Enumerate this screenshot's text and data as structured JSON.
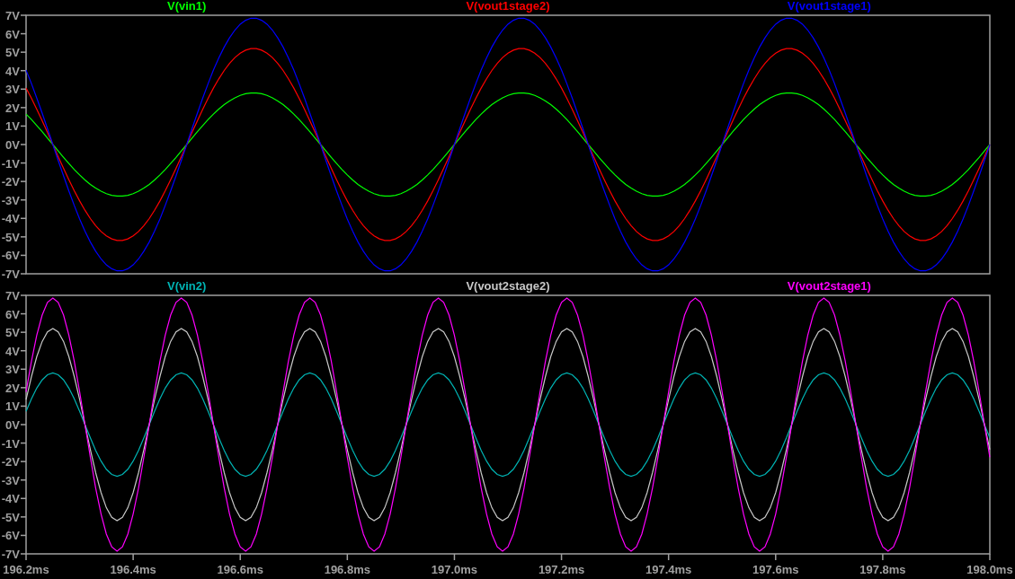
{
  "top_panel": {
    "chart_data": {
      "type": "line",
      "x": [
        196.2,
        196.21,
        196.22,
        196.23,
        196.24,
        196.25,
        196.26,
        196.27,
        196.28,
        196.29,
        196.3,
        196.31,
        196.32,
        196.33,
        196.34,
        196.35,
        196.36,
        196.37,
        196.38,
        196.39,
        196.4,
        196.41,
        196.42,
        196.43,
        196.44,
        196.45,
        196.46,
        196.47,
        196.48,
        196.49,
        196.5,
        196.51,
        196.52,
        196.53,
        196.54,
        196.55,
        196.56,
        196.57,
        196.58,
        196.59,
        196.6,
        196.61,
        196.62,
        196.63,
        196.64,
        196.65,
        196.66,
        196.67,
        196.68,
        196.69,
        196.7,
        196.71,
        196.72,
        196.73,
        196.74,
        196.75,
        196.76,
        196.77,
        196.78,
        196.79,
        196.8,
        196.81,
        196.82,
        196.83,
        196.84,
        196.85,
        196.86,
        196.87,
        196.88,
        196.89,
        196.9,
        196.91,
        196.92,
        196.93,
        196.94,
        196.95,
        196.96,
        196.97,
        196.98,
        196.99,
        197,
        197.01,
        197.02,
        197.03,
        197.04,
        197.05,
        197.06,
        197.07,
        197.08,
        197.09,
        197.1,
        197.11,
        197.12,
        197.13,
        197.14,
        197.15,
        197.16,
        197.17,
        197.18,
        197.19,
        197.2,
        197.21,
        197.22,
        197.23,
        197.24,
        197.25,
        197.26,
        197.27,
        197.28,
        197.29,
        197.3,
        197.31,
        197.32,
        197.33,
        197.34,
        197.35,
        197.36,
        197.37,
        197.38,
        197.39,
        197.4,
        197.41,
        197.42,
        197.43,
        197.44,
        197.45,
        197.46,
        197.47,
        197.48,
        197.49,
        197.5,
        197.51,
        197.52,
        197.53,
        197.54,
        197.55,
        197.56,
        197.57,
        197.58,
        197.59,
        197.6,
        197.61,
        197.62,
        197.63,
        197.64,
        197.65,
        197.66,
        197.67,
        197.68,
        197.69,
        197.7,
        197.71,
        197.72,
        197.73,
        197.74,
        197.75,
        197.76,
        197.77,
        197.78,
        197.79,
        197.8,
        197.81,
        197.82,
        197.83,
        197.84,
        197.85,
        197.86,
        197.87,
        197.88,
        197.89,
        197.9,
        197.91,
        197.92,
        197.93,
        197.94,
        197.95,
        197.96,
        197.97,
        197.98,
        197.99,
        198
      ],
      "series": [
        {
          "name": "V(vin1)",
          "color": "#00ff00",
          "values": [
            1.65,
            1.35,
            1.03,
            0.7,
            0.35,
            0,
            -0.35,
            -0.7,
            -1.03,
            -1.35,
            -1.65,
            -1.92,
            -2.16,
            -2.36,
            -2.53,
            -2.66,
            -2.75,
            -2.79,
            -2.79,
            -2.75,
            -2.66,
            -2.53,
            -2.36,
            -2.16,
            -1.92,
            -1.65,
            -1.35,
            -1.03,
            -0.7,
            -0.35,
            0,
            0.35,
            0.7,
            1.03,
            1.35,
            1.65,
            1.92,
            2.16,
            2.36,
            2.53,
            2.66,
            2.75,
            2.79,
            2.79,
            2.75,
            2.66,
            2.53,
            2.36,
            2.16,
            1.92,
            1.65,
            1.35,
            1.03,
            0.7,
            0.35,
            0,
            -0.35,
            -0.7,
            -1.03,
            -1.35,
            -1.65,
            -1.92,
            -2.16,
            -2.36,
            -2.53,
            -2.66,
            -2.75,
            -2.79,
            -2.79,
            -2.75,
            -2.66,
            -2.53,
            -2.36,
            -2.16,
            -1.92,
            -1.65,
            -1.35,
            -1.03,
            -0.7,
            -0.35,
            0,
            0.35,
            0.7,
            1.03,
            1.35,
            1.65,
            1.92,
            2.16,
            2.36,
            2.53,
            2.66,
            2.75,
            2.79,
            2.79,
            2.75,
            2.66,
            2.53,
            2.36,
            2.16,
            1.92,
            1.65,
            1.35,
            1.03,
            0.7,
            0.35,
            0,
            -0.35,
            -0.7,
            -1.03,
            -1.35,
            -1.65,
            -1.92,
            -2.16,
            -2.36,
            -2.53,
            -2.66,
            -2.75,
            -2.79,
            -2.79,
            -2.75,
            -2.66,
            -2.53,
            -2.36,
            -2.16,
            -1.92,
            -1.65,
            -1.35,
            -1.03,
            -0.7,
            -0.35,
            0,
            0.35,
            0.7,
            1.03,
            1.35,
            1.65,
            1.92,
            2.16,
            2.36,
            2.53,
            2.66,
            2.75,
            2.79,
            2.79,
            2.75,
            2.66,
            2.53,
            2.36,
            2.16,
            1.92,
            1.65,
            1.35,
            1.03,
            0.7,
            0.35,
            0,
            -0.35,
            -0.7,
            -1.03,
            -1.35,
            -1.65,
            -1.92,
            -2.16,
            -2.36,
            -2.53,
            -2.66,
            -2.75,
            -2.79,
            -2.79,
            -2.75,
            -2.66,
            -2.53,
            -2.36,
            -2.16,
            -1.92,
            -1.65,
            -1.35,
            -1.03,
            -0.7,
            -0.35,
            0
          ]
        },
        {
          "name": "V(vout1stage2)",
          "color": "#ff0000",
          "values": [
            3.06,
            2.51,
            1.91,
            1.29,
            0.65,
            0,
            -0.65,
            -1.29,
            -1.91,
            -2.51,
            -3.06,
            -3.56,
            -4.01,
            -4.39,
            -4.71,
            -4.95,
            -5.11,
            -5.19,
            -5.19,
            -5.11,
            -4.95,
            -4.71,
            -4.39,
            -4.01,
            -3.56,
            -3.06,
            -2.51,
            -1.91,
            -1.29,
            -0.65,
            0,
            0.65,
            1.29,
            1.91,
            2.51,
            3.06,
            3.56,
            4.01,
            4.39,
            4.71,
            4.95,
            5.11,
            5.19,
            5.19,
            5.11,
            4.95,
            4.71,
            4.39,
            4.01,
            3.56,
            3.06,
            2.51,
            1.91,
            1.29,
            0.65,
            0,
            -0.65,
            -1.29,
            -1.91,
            -2.51,
            -3.06,
            -3.56,
            -4.01,
            -4.39,
            -4.71,
            -4.95,
            -5.11,
            -5.19,
            -5.19,
            -5.11,
            -4.95,
            -4.71,
            -4.39,
            -4.01,
            -3.56,
            -3.06,
            -2.51,
            -1.91,
            -1.29,
            -0.65,
            0,
            0.65,
            1.29,
            1.91,
            2.51,
            3.06,
            3.56,
            4.01,
            4.39,
            4.71,
            4.95,
            5.11,
            5.19,
            5.19,
            5.11,
            4.95,
            4.71,
            4.39,
            4.01,
            3.56,
            3.06,
            2.51,
            1.91,
            1.29,
            0.65,
            0,
            -0.65,
            -1.29,
            -1.91,
            -2.51,
            -3.06,
            -3.56,
            -4.01,
            -4.39,
            -4.71,
            -4.95,
            -5.11,
            -5.19,
            -5.19,
            -5.11,
            -4.95,
            -4.71,
            -4.39,
            -4.01,
            -3.56,
            -3.06,
            -2.51,
            -1.91,
            -1.29,
            -0.65,
            0,
            0.65,
            1.29,
            1.91,
            2.51,
            3.06,
            3.56,
            4.01,
            4.39,
            4.71,
            4.95,
            5.11,
            5.19,
            5.19,
            5.11,
            4.95,
            4.71,
            4.39,
            4.01,
            3.56,
            3.06,
            2.51,
            1.91,
            1.29,
            0.65,
            0,
            -0.65,
            -1.29,
            -1.91,
            -2.51,
            -3.06,
            -3.56,
            -4.01,
            -4.39,
            -4.71,
            -4.95,
            -5.11,
            -5.19,
            -5.19,
            -5.11,
            -4.95,
            -4.71,
            -4.39,
            -4.01,
            -3.56,
            -3.06,
            -2.51,
            -1.91,
            -1.29,
            -0.65,
            0
          ]
        },
        {
          "name": "V(vout1stage1)",
          "color": "#0000ff",
          "values": [
            4.03,
            3.3,
            2.52,
            1.7,
            0.86,
            0,
            -0.86,
            -1.7,
            -2.52,
            -3.3,
            -4.03,
            -4.69,
            -5.28,
            -5.78,
            -6.2,
            -6.52,
            -6.73,
            -6.84,
            -6.84,
            -6.73,
            -6.52,
            -6.2,
            -5.78,
            -5.28,
            -4.69,
            -4.03,
            -3.3,
            -2.52,
            -1.7,
            -0.86,
            0,
            0.86,
            1.7,
            2.52,
            3.3,
            4.03,
            4.69,
            5.28,
            5.78,
            6.2,
            6.52,
            6.73,
            6.84,
            6.84,
            6.73,
            6.52,
            6.2,
            5.78,
            5.28,
            4.69,
            4.03,
            3.3,
            2.52,
            1.7,
            0.86,
            0,
            -0.86,
            -1.7,
            -2.52,
            -3.3,
            -4.03,
            -4.69,
            -5.28,
            -5.78,
            -6.2,
            -6.52,
            -6.73,
            -6.84,
            -6.84,
            -6.73,
            -6.52,
            -6.2,
            -5.78,
            -5.28,
            -4.69,
            -4.03,
            -3.3,
            -2.52,
            -1.7,
            -0.86,
            0,
            0.86,
            1.7,
            2.52,
            3.3,
            4.03,
            4.69,
            5.28,
            5.78,
            6.2,
            6.52,
            6.73,
            6.84,
            6.84,
            6.73,
            6.52,
            6.2,
            5.78,
            5.28,
            4.69,
            4.03,
            3.3,
            2.52,
            1.7,
            0.86,
            0,
            -0.86,
            -1.7,
            -2.52,
            -3.3,
            -4.03,
            -4.69,
            -5.28,
            -5.78,
            -6.2,
            -6.52,
            -6.73,
            -6.84,
            -6.84,
            -6.73,
            -6.52,
            -6.2,
            -5.78,
            -5.28,
            -4.69,
            -4.03,
            -3.3,
            -2.52,
            -1.7,
            -0.86,
            0,
            0.86,
            1.7,
            2.52,
            3.3,
            4.03,
            4.69,
            5.28,
            5.78,
            6.2,
            6.52,
            6.73,
            6.84,
            6.84,
            6.73,
            6.52,
            6.2,
            5.78,
            5.28,
            4.69,
            4.03,
            3.3,
            2.52,
            1.7,
            0.86,
            0,
            -0.86,
            -1.7,
            -2.52,
            -3.3,
            -4.03,
            -4.69,
            -5.28,
            -5.78,
            -6.2,
            -6.52,
            -6.73,
            -6.84,
            -6.84,
            -6.73,
            -6.52,
            -6.2,
            -5.78,
            -5.28,
            -4.69,
            -4.03,
            -3.3,
            -2.52,
            -1.7,
            -0.86,
            0
          ]
        }
      ],
      "xlim": [
        196.2,
        198.0
      ],
      "ylim": [
        -7,
        7
      ],
      "yticks": [
        {
          "value": 7,
          "label": "7V"
        },
        {
          "value": 6,
          "label": "6V"
        },
        {
          "value": 5,
          "label": "5V"
        },
        {
          "value": 4,
          "label": "4V"
        },
        {
          "value": 3,
          "label": "3V"
        },
        {
          "value": 2,
          "label": "2V"
        },
        {
          "value": 1,
          "label": "1V"
        },
        {
          "value": 0,
          "label": "0V"
        },
        {
          "value": -1,
          "label": "-1V"
        },
        {
          "value": -2,
          "label": "-2V"
        },
        {
          "value": -3,
          "label": "-3V"
        },
        {
          "value": -4,
          "label": "-4V"
        },
        {
          "value": -5,
          "label": "-5V"
        },
        {
          "value": -6,
          "label": "-6V"
        },
        {
          "value": -7,
          "label": "-7V"
        }
      ]
    }
  },
  "bottom_panel": {
    "chart_data": {
      "type": "line",
      "x": [
        196.2,
        196.21,
        196.22,
        196.23,
        196.24,
        196.25,
        196.26,
        196.27,
        196.28,
        196.29,
        196.3,
        196.31,
        196.32,
        196.33,
        196.34,
        196.35,
        196.36,
        196.37,
        196.38,
        196.39,
        196.4,
        196.41,
        196.42,
        196.43,
        196.44,
        196.45,
        196.46,
        196.47,
        196.48,
        196.49,
        196.5,
        196.51,
        196.52,
        196.53,
        196.54,
        196.55,
        196.56,
        196.57,
        196.58,
        196.59,
        196.6,
        196.61,
        196.62,
        196.63,
        196.64,
        196.65,
        196.66,
        196.67,
        196.68,
        196.69,
        196.7,
        196.71,
        196.72,
        196.73,
        196.74,
        196.75,
        196.76,
        196.77,
        196.78,
        196.79,
        196.8,
        196.81,
        196.82,
        196.83,
        196.84,
        196.85,
        196.86,
        196.87,
        196.88,
        196.89,
        196.9,
        196.91,
        196.92,
        196.93,
        196.94,
        196.95,
        196.96,
        196.97,
        196.98,
        196.99,
        197,
        197.01,
        197.02,
        197.03,
        197.04,
        197.05,
        197.06,
        197.07,
        197.08,
        197.09,
        197.1,
        197.11,
        197.12,
        197.13,
        197.14,
        197.15,
        197.16,
        197.17,
        197.18,
        197.19,
        197.2,
        197.21,
        197.22,
        197.23,
        197.24,
        197.25,
        197.26,
        197.27,
        197.28,
        197.29,
        197.3,
        197.31,
        197.32,
        197.33,
        197.34,
        197.35,
        197.36,
        197.37,
        197.38,
        197.39,
        197.4,
        197.41,
        197.42,
        197.43,
        197.44,
        197.45,
        197.46,
        197.47,
        197.48,
        197.49,
        197.5,
        197.51,
        197.52,
        197.53,
        197.54,
        197.55,
        197.56,
        197.57,
        197.58,
        197.59,
        197.6,
        197.61,
        197.62,
        197.63,
        197.64,
        197.65,
        197.66,
        197.67,
        197.68,
        197.69,
        197.7,
        197.71,
        197.72,
        197.73,
        197.74,
        197.75,
        197.76,
        197.77,
        197.78,
        197.79,
        197.8,
        197.81,
        197.82,
        197.83,
        197.84,
        197.85,
        197.86,
        197.87,
        197.88,
        197.89,
        197.9,
        197.91,
        197.92,
        197.93,
        197.94,
        197.95,
        197.96,
        197.97,
        197.98,
        197.99,
        198
      ],
      "series": [
        {
          "name": "V(vin2)",
          "color": "#00b4b4",
          "values": [
            0.72,
            1.4,
            1.98,
            2.42,
            2.7,
            2.8,
            2.7,
            2.42,
            1.98,
            1.4,
            0.72,
            0,
            -0.72,
            -1.4,
            -1.98,
            -2.42,
            -2.7,
            -2.8,
            -2.7,
            -2.42,
            -1.98,
            -1.4,
            -0.72,
            0,
            0.72,
            1.4,
            1.98,
            2.42,
            2.7,
            2.8,
            2.7,
            2.42,
            1.98,
            1.4,
            0.72,
            0,
            -0.72,
            -1.4,
            -1.98,
            -2.42,
            -2.7,
            -2.8,
            -2.7,
            -2.42,
            -1.98,
            -1.4,
            -0.72,
            0,
            0.72,
            1.4,
            1.98,
            2.42,
            2.7,
            2.8,
            2.7,
            2.42,
            1.98,
            1.4,
            0.72,
            0,
            -0.72,
            -1.4,
            -1.98,
            -2.42,
            -2.7,
            -2.8,
            -2.7,
            -2.42,
            -1.98,
            -1.4,
            -0.72,
            0,
            0.72,
            1.4,
            1.98,
            2.42,
            2.7,
            2.8,
            2.7,
            2.42,
            1.98,
            1.4,
            0.72,
            0,
            -0.72,
            -1.4,
            -1.98,
            -2.42,
            -2.7,
            -2.8,
            -2.7,
            -2.42,
            -1.98,
            -1.4,
            -0.72,
            0,
            0.72,
            1.4,
            1.98,
            2.42,
            2.7,
            2.8,
            2.7,
            2.42,
            1.98,
            1.4,
            0.72,
            0,
            -0.72,
            -1.4,
            -1.98,
            -2.42,
            -2.7,
            -2.8,
            -2.7,
            -2.42,
            -1.98,
            -1.4,
            -0.72,
            0,
            0.72,
            1.4,
            1.98,
            2.42,
            2.7,
            2.8,
            2.7,
            2.42,
            1.98,
            1.4,
            0.72,
            0,
            -0.72,
            -1.4,
            -1.98,
            -2.42,
            -2.7,
            -2.8,
            -2.7,
            -2.42,
            -1.98,
            -1.4,
            -0.72,
            0,
            0.72,
            1.4,
            1.98,
            2.42,
            2.7,
            2.8,
            2.7,
            2.42,
            1.98,
            1.4,
            0.72,
            0,
            -0.72,
            -1.4,
            -1.98,
            -2.42,
            -2.7,
            -2.8,
            -2.7,
            -2.42,
            -1.98,
            -1.4,
            -0.72,
            0,
            0.72,
            1.4,
            1.98,
            2.42,
            2.7,
            2.8,
            2.7,
            2.42,
            1.98,
            1.4,
            0.72,
            0,
            -0.72
          ]
        },
        {
          "name": "V(vout2stage2)",
          "color": "#c8c8c8",
          "values": [
            1.35,
            2.6,
            3.68,
            4.5,
            5.02,
            5.2,
            5.02,
            4.5,
            3.68,
            2.6,
            1.35,
            0,
            -1.35,
            -2.6,
            -3.68,
            -4.5,
            -5.02,
            -5.2,
            -5.02,
            -4.5,
            -3.68,
            -2.6,
            -1.35,
            0,
            1.35,
            2.6,
            3.68,
            4.5,
            5.02,
            5.2,
            5.02,
            4.5,
            3.68,
            2.6,
            1.35,
            0,
            -1.35,
            -2.6,
            -3.68,
            -4.5,
            -5.02,
            -5.2,
            -5.02,
            -4.5,
            -3.68,
            -2.6,
            -1.35,
            0,
            1.35,
            2.6,
            3.68,
            4.5,
            5.02,
            5.2,
            5.02,
            4.5,
            3.68,
            2.6,
            1.35,
            0,
            -1.35,
            -2.6,
            -3.68,
            -4.5,
            -5.02,
            -5.2,
            -5.02,
            -4.5,
            -3.68,
            -2.6,
            -1.35,
            0,
            1.35,
            2.6,
            3.68,
            4.5,
            5.02,
            5.2,
            5.02,
            4.5,
            3.68,
            2.6,
            1.35,
            0,
            -1.35,
            -2.6,
            -3.68,
            -4.5,
            -5.02,
            -5.2,
            -5.02,
            -4.5,
            -3.68,
            -2.6,
            -1.35,
            0,
            1.35,
            2.6,
            3.68,
            4.5,
            5.02,
            5.2,
            5.02,
            4.5,
            3.68,
            2.6,
            1.35,
            0,
            -1.35,
            -2.6,
            -3.68,
            -4.5,
            -5.02,
            -5.2,
            -5.02,
            -4.5,
            -3.68,
            -2.6,
            -1.35,
            0,
            1.35,
            2.6,
            3.68,
            4.5,
            5.02,
            5.2,
            5.02,
            4.5,
            3.68,
            2.6,
            1.35,
            0,
            -1.35,
            -2.6,
            -3.68,
            -4.5,
            -5.02,
            -5.2,
            -5.02,
            -4.5,
            -3.68,
            -2.6,
            -1.35,
            0,
            1.35,
            2.6,
            3.68,
            4.5,
            5.02,
            5.2,
            5.02,
            4.5,
            3.68,
            2.6,
            1.35,
            0,
            -1.35,
            -2.6,
            -3.68,
            -4.5,
            -5.02,
            -5.2,
            -5.02,
            -4.5,
            -3.68,
            -2.6,
            -1.35,
            0,
            1.35,
            2.6,
            3.68,
            4.5,
            5.02,
            5.2,
            5.02,
            4.5,
            3.68,
            2.6,
            1.35,
            0,
            -1.35
          ]
        },
        {
          "name": "V(vout2stage1)",
          "color": "#ff00ff",
          "values": [
            1.77,
            3.43,
            4.84,
            5.93,
            6.62,
            6.85,
            6.62,
            5.93,
            4.84,
            3.43,
            1.77,
            0,
            -1.77,
            -3.43,
            -4.84,
            -5.93,
            -6.62,
            -6.85,
            -6.62,
            -5.93,
            -4.84,
            -3.43,
            -1.77,
            0,
            1.77,
            3.43,
            4.84,
            5.93,
            6.62,
            6.85,
            6.62,
            5.93,
            4.84,
            3.43,
            1.77,
            0,
            -1.77,
            -3.43,
            -4.84,
            -5.93,
            -6.62,
            -6.85,
            -6.62,
            -5.93,
            -4.84,
            -3.43,
            -1.77,
            0,
            1.77,
            3.43,
            4.84,
            5.93,
            6.62,
            6.85,
            6.62,
            5.93,
            4.84,
            3.43,
            1.77,
            0,
            -1.77,
            -3.43,
            -4.84,
            -5.93,
            -6.62,
            -6.85,
            -6.62,
            -5.93,
            -4.84,
            -3.43,
            -1.77,
            0,
            1.77,
            3.43,
            4.84,
            5.93,
            6.62,
            6.85,
            6.62,
            5.93,
            4.84,
            3.43,
            1.77,
            0,
            -1.77,
            -3.43,
            -4.84,
            -5.93,
            -6.62,
            -6.85,
            -6.62,
            -5.93,
            -4.84,
            -3.43,
            -1.77,
            0,
            1.77,
            3.43,
            4.84,
            5.93,
            6.62,
            6.85,
            6.62,
            5.93,
            4.84,
            3.43,
            1.77,
            0,
            -1.77,
            -3.43,
            -4.84,
            -5.93,
            -6.62,
            -6.85,
            -6.62,
            -5.93,
            -4.84,
            -3.43,
            -1.77,
            0,
            1.77,
            3.43,
            4.84,
            5.93,
            6.62,
            6.85,
            6.62,
            5.93,
            4.84,
            3.43,
            1.77,
            0,
            -1.77,
            -3.43,
            -4.84,
            -5.93,
            -6.62,
            -6.85,
            -6.62,
            -5.93,
            -4.84,
            -3.43,
            -1.77,
            0,
            1.77,
            3.43,
            4.84,
            5.93,
            6.62,
            6.85,
            6.62,
            5.93,
            4.84,
            3.43,
            1.77,
            0,
            -1.77,
            -3.43,
            -4.84,
            -5.93,
            -6.62,
            -6.85,
            -6.62,
            -5.93,
            -4.84,
            -3.43,
            -1.77,
            0,
            1.77,
            3.43,
            4.84,
            5.93,
            6.62,
            6.85,
            6.62,
            5.93,
            4.84,
            3.43,
            1.77,
            0,
            -1.77
          ]
        }
      ],
      "xlim": [
        196.2,
        198.0
      ],
      "ylim": [
        -7,
        7
      ],
      "xticks": [
        {
          "value": 196.2,
          "label": "196.2ms"
        },
        {
          "value": 196.4,
          "label": "196.4ms"
        },
        {
          "value": 196.6,
          "label": "196.6ms"
        },
        {
          "value": 196.8,
          "label": "196.8ms"
        },
        {
          "value": 197.0,
          "label": "197.0ms"
        },
        {
          "value": 197.2,
          "label": "197.2ms"
        },
        {
          "value": 197.4,
          "label": "197.4ms"
        },
        {
          "value": 197.6,
          "label": "197.6ms"
        },
        {
          "value": 197.8,
          "label": "197.8ms"
        },
        {
          "value": 198.0,
          "label": "198.0ms"
        }
      ],
      "yticks": [
        {
          "value": 7,
          "label": "7V"
        },
        {
          "value": 6,
          "label": "6V"
        },
        {
          "value": 5,
          "label": "5V"
        },
        {
          "value": 4,
          "label": "4V"
        },
        {
          "value": 3,
          "label": "3V"
        },
        {
          "value": 2,
          "label": "2V"
        },
        {
          "value": 1,
          "label": "1V"
        },
        {
          "value": 0,
          "label": "0V"
        },
        {
          "value": -1,
          "label": "-1V"
        },
        {
          "value": -2,
          "label": "-2V"
        },
        {
          "value": -3,
          "label": "-3V"
        },
        {
          "value": -4,
          "label": "-4V"
        },
        {
          "value": -5,
          "label": "-5V"
        },
        {
          "value": -6,
          "label": "-6V"
        },
        {
          "value": -7,
          "label": "-7V"
        }
      ]
    }
  }
}
